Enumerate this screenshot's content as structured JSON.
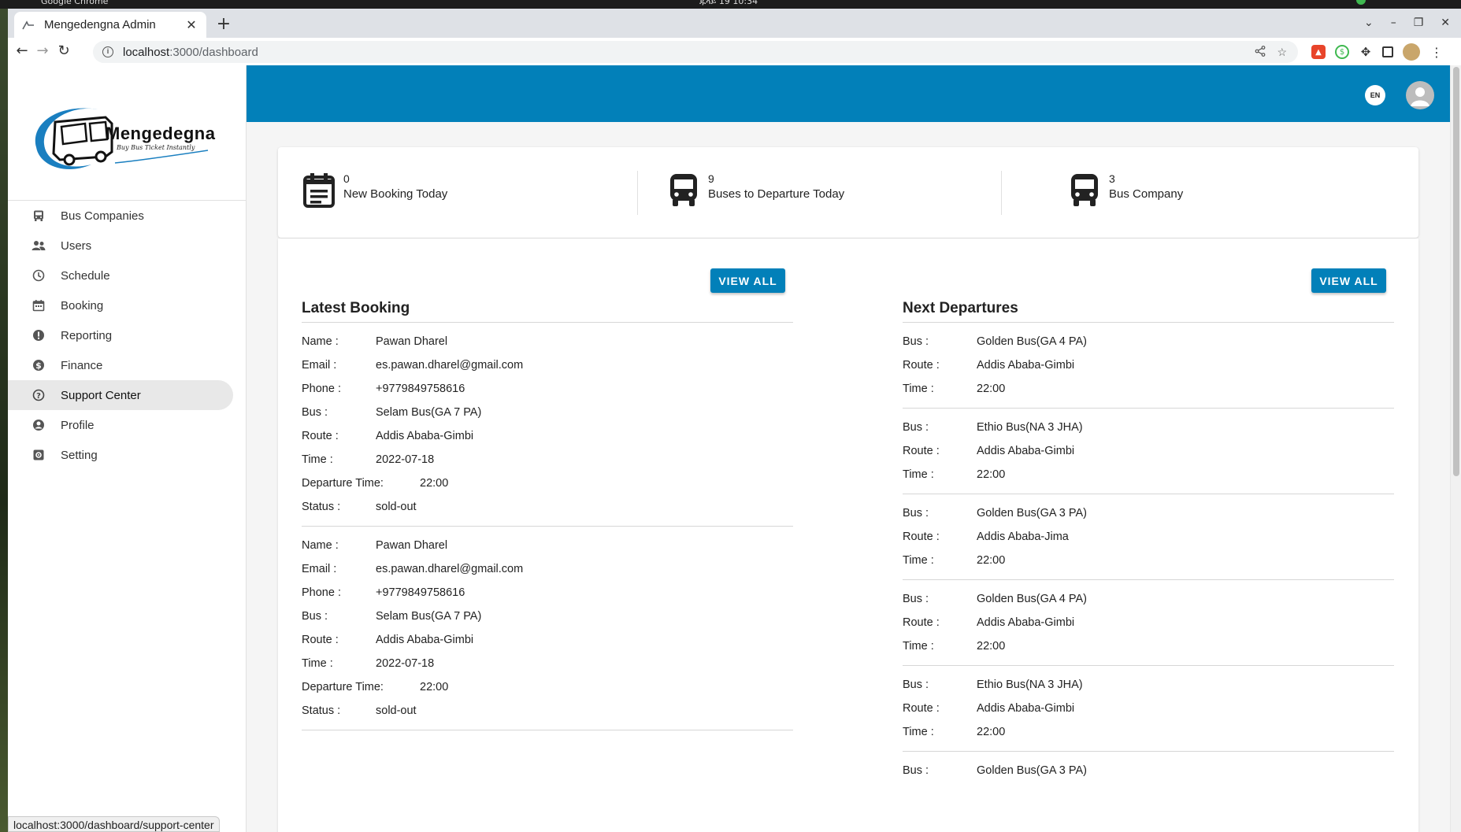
{
  "os": {
    "app_name": "Google Chrome",
    "clock": "ጁላይ 19 10:34"
  },
  "browser": {
    "tab_title": "Mengedengna Admin",
    "url_host": "localhost",
    "url_path": ":3000/dashboard",
    "status_url": "localhost:3000/dashboard/support-center"
  },
  "brand": {
    "name": "Mengedegna",
    "tagline": "Buy Bus Ticket Instantly",
    "color": "#0280b9"
  },
  "sidebar": {
    "items": [
      {
        "label": "Bus Companies",
        "icon": "bus-icon"
      },
      {
        "label": "Users",
        "icon": "users-icon"
      },
      {
        "label": "Schedule",
        "icon": "clock-icon"
      },
      {
        "label": "Booking",
        "icon": "calendar-icon"
      },
      {
        "label": "Reporting",
        "icon": "alert-icon"
      },
      {
        "label": "Finance",
        "icon": "dollar-icon"
      },
      {
        "label": "Support Center",
        "icon": "help-icon",
        "active": true
      },
      {
        "label": "Profile",
        "icon": "account-icon"
      },
      {
        "label": "Setting",
        "icon": "settings-icon"
      }
    ]
  },
  "header": {
    "lang": "EN"
  },
  "stats": [
    {
      "value": "0",
      "label": "New Booking Today",
      "icon": "calendar-note-icon"
    },
    {
      "value": "9",
      "label": "Buses to Departure Today",
      "icon": "bus-icon"
    },
    {
      "value": "3",
      "label": "Bus Company",
      "icon": "bus-icon"
    }
  ],
  "latest_booking": {
    "title": "Latest Booking",
    "view_all": "VIEW ALL",
    "labels": {
      "name": "Name :",
      "email": "Email :",
      "phone": "Phone :",
      "bus": "Bus :",
      "route": "Route :",
      "time": "Time :",
      "departure": "Departure Time:",
      "status": "Status :"
    },
    "entries": [
      {
        "name": "Pawan Dharel",
        "email": "es.pawan.dharel@gmail.com",
        "phone": "+9779849758616",
        "bus": "Selam Bus(GA 7 PA)",
        "route": "Addis Ababa-Gimbi",
        "time": "2022-07-18",
        "departure": "22:00",
        "status": "sold-out"
      },
      {
        "name": "Pawan Dharel",
        "email": "es.pawan.dharel@gmail.com",
        "phone": "+9779849758616",
        "bus": "Selam Bus(GA 7 PA)",
        "route": "Addis Ababa-Gimbi",
        "time": "2022-07-18",
        "departure": "22:00",
        "status": "sold-out"
      }
    ]
  },
  "next_departures": {
    "title": "Next Departures",
    "view_all": "VIEW ALL",
    "labels": {
      "bus": "Bus :",
      "route": "Route :",
      "time": "Time :"
    },
    "entries": [
      {
        "bus": "Golden Bus(GA 4 PA)",
        "route": "Addis Ababa-Gimbi",
        "time": "22:00"
      },
      {
        "bus": "Ethio Bus(NA 3 JHA)",
        "route": "Addis Ababa-Gimbi",
        "time": "22:00"
      },
      {
        "bus": "Golden Bus(GA 3 PA)",
        "route": "Addis Ababa-Jima",
        "time": "22:00"
      },
      {
        "bus": "Golden Bus(GA 4 PA)",
        "route": "Addis Ababa-Gimbi",
        "time": "22:00"
      },
      {
        "bus": "Ethio Bus(NA 3 JHA)",
        "route": "Addis Ababa-Gimbi",
        "time": "22:00"
      },
      {
        "bus": "Golden Bus(GA 3 PA)",
        "route": "",
        "time": ""
      }
    ]
  }
}
